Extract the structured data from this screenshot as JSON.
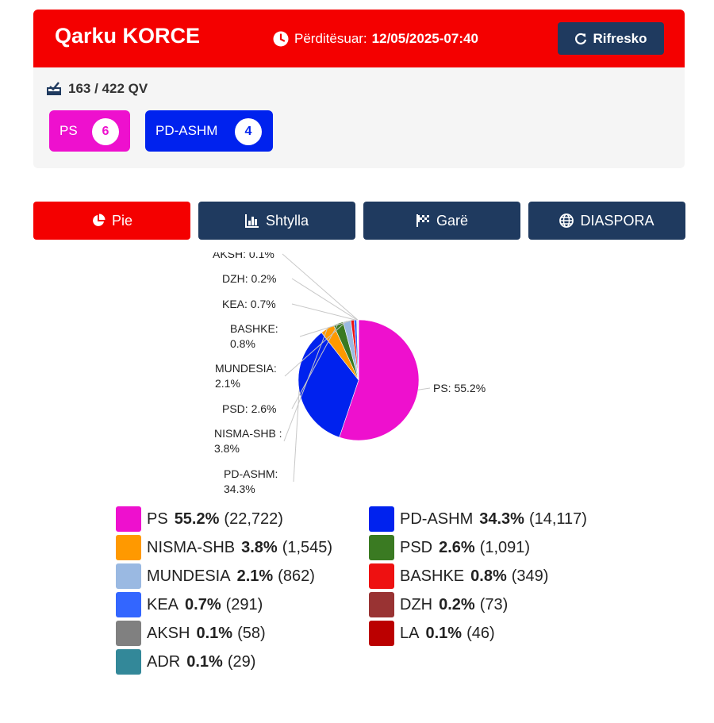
{
  "header": {
    "title": "Qarku KORCE",
    "updated_label": "Përditësuar:",
    "updated_value": "12/05/2025-07:40",
    "refresh_label": "Rifresko"
  },
  "summary": {
    "qv_text": "163 / 422 QV",
    "seats": [
      {
        "party": "PS",
        "count": "6",
        "color": "#ee10ce"
      },
      {
        "party": "PD-ASHM",
        "count": "4",
        "color": "#0022ee"
      }
    ]
  },
  "tabs": [
    {
      "label": "Pie",
      "icon": "pie-chart-icon",
      "active": true
    },
    {
      "label": "Shtylla",
      "icon": "bar-chart-icon",
      "active": false
    },
    {
      "label": "Garë",
      "icon": "race-flag-icon",
      "active": false
    },
    {
      "label": "DIASPORA",
      "icon": "globe-icon",
      "active": false
    }
  ],
  "chart_data": {
    "type": "pie",
    "slices": [
      {
        "name": "PS",
        "value": 22722,
        "percent": "55.2%",
        "votes": "(22,722)",
        "color": "#ee10ce",
        "label": "PS: 55.2%"
      },
      {
        "name": "PD-ASHM",
        "value": 14117,
        "percent": "34.3%",
        "votes": "(14,117)",
        "color": "#0022ee",
        "label": "PD-ASHM: 34.3%"
      },
      {
        "name": "NISMA-SHB",
        "value": 1545,
        "percent": "3.8%",
        "votes": "(1,545)",
        "color": "#ff9900",
        "label": "NISMA-SHB : 3.8%"
      },
      {
        "name": "PSD",
        "value": 1091,
        "percent": "2.6%",
        "votes": "(1,091)",
        "color": "#3a7a22",
        "label": "PSD: 2.6%"
      },
      {
        "name": "MUNDESIA",
        "value": 862,
        "percent": "2.1%",
        "votes": "(862)",
        "color": "#9ab9e2",
        "label": "MUNDESIA: 2.1%"
      },
      {
        "name": "BASHKE",
        "value": 349,
        "percent": "0.8%",
        "votes": "(349)",
        "color": "#ee1111",
        "label": "BASHKE: 0.8%"
      },
      {
        "name": "KEA",
        "value": 291,
        "percent": "0.7%",
        "votes": "(291)",
        "color": "#3366ff",
        "label": "KEA: 0.7%"
      },
      {
        "name": "DZH",
        "value": 73,
        "percent": "0.2%",
        "votes": "(73)",
        "color": "#993333",
        "label": "DZH: 0.2%"
      },
      {
        "name": "AKSH",
        "value": 58,
        "percent": "0.1%",
        "votes": "(58)",
        "color": "#808080",
        "label": "AKSH: 0.1%"
      },
      {
        "name": "LA",
        "value": 46,
        "percent": "0.1%",
        "votes": "(46)",
        "color": "#bb0000",
        "label": ""
      },
      {
        "name": "ADR",
        "value": 29,
        "percent": "0.1%",
        "votes": "(29)",
        "color": "#338899",
        "label": ""
      }
    ]
  }
}
